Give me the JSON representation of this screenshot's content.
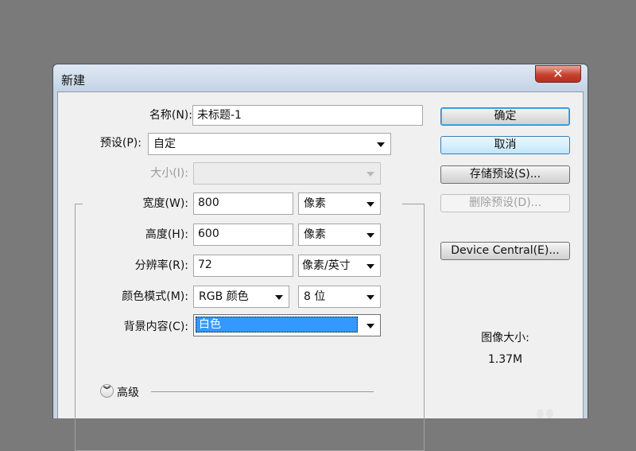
{
  "window": {
    "title": "新建",
    "close_label": "✕"
  },
  "form": {
    "name": {
      "label": "名称(N):",
      "value": "未标题-1"
    },
    "preset": {
      "label": "预设(P):",
      "value": "自定"
    },
    "size": {
      "label": "大小(I):",
      "value": ""
    },
    "width": {
      "label": "宽度(W):",
      "value": "800",
      "unit": "像素"
    },
    "height": {
      "label": "高度(H):",
      "value": "600",
      "unit": "像素"
    },
    "resolution": {
      "label": "分辨率(R):",
      "value": "72",
      "unit": "像素/英寸"
    },
    "color_mode": {
      "label": "颜色模式(M):",
      "mode": "RGB 颜色",
      "depth": "8 位"
    },
    "background": {
      "label": "背景内容(C):",
      "value": "白色"
    },
    "advanced": {
      "label": "高级"
    }
  },
  "buttons": {
    "ok": "确定",
    "cancel": "取消",
    "save_preset": "存储预设(S)...",
    "delete_preset": "删除预设(D)...",
    "device_central": "Device Central(E)..."
  },
  "image_size": {
    "label": "图像大小:",
    "value": "1.37M"
  },
  "colors": {
    "selection": "#3399ff",
    "desktop": "#7a7a7a",
    "close_button": "#c8412f"
  }
}
